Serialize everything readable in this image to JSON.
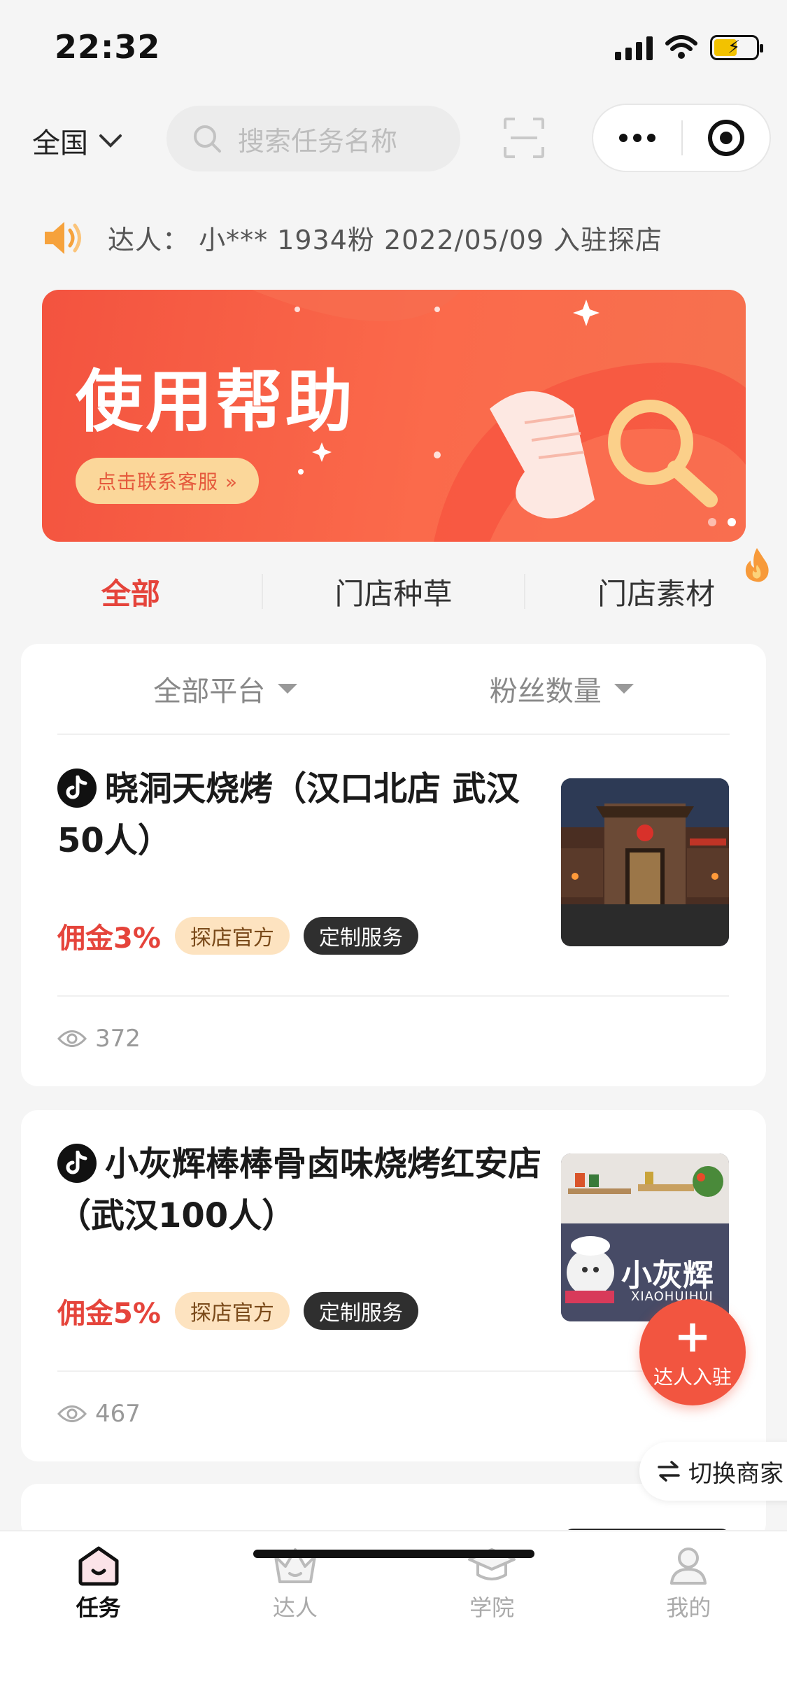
{
  "status_bar": {
    "time": "22:32"
  },
  "topnav": {
    "region": "全国",
    "search_placeholder": "搜索任务名称"
  },
  "notice": {
    "text": "达人： 小*** 1934粉 2022/05/09 入驻探店"
  },
  "banner": {
    "title": "使用帮助",
    "button": "点击联系客服 »",
    "slides": 2,
    "active_slide": 2
  },
  "tabs": [
    {
      "label": "全部",
      "active": true
    },
    {
      "label": "门店种草",
      "active": false
    },
    {
      "label": "门店素材",
      "active": false,
      "hot": true
    }
  ],
  "filters": [
    {
      "label": "全部平台"
    },
    {
      "label": "粉丝数量"
    }
  ],
  "tasks": [
    {
      "platform_icon": "tiktok-icon",
      "title": "晓洞天烧烤（汉口北店 武汉50人）",
      "commission": "佣金3%",
      "tags": [
        "探店官方",
        "定制服务"
      ],
      "views": "372"
    },
    {
      "platform_icon": "tiktok-icon",
      "title": "小灰辉棒棒骨卤味烧烤红安店（武汉100人）",
      "commission": "佣金5%",
      "tags": [
        "探店官方",
        "定制服务"
      ],
      "views": "467",
      "thumb_sign": "小灰辉",
      "thumb_sign_sub": "XIAOHUIHUI"
    }
  ],
  "fab": {
    "plus": "+",
    "label": "达人入驻"
  },
  "switch_merchant": {
    "icon": "swap-icon",
    "label": "切换商家"
  },
  "bottom_nav": [
    {
      "label": "任务",
      "icon": "home-icon",
      "active": true
    },
    {
      "label": "达人",
      "icon": "crown-icon",
      "active": false
    },
    {
      "label": "学院",
      "icon": "graduation-cap-icon",
      "active": false
    },
    {
      "label": "我的",
      "icon": "person-icon",
      "active": false
    }
  ],
  "colors": {
    "accent": "#e5443b",
    "banner": "#f3533f",
    "tag_official_bg": "#fde3c0",
    "tag_custom_bg": "#2f2f2f"
  }
}
